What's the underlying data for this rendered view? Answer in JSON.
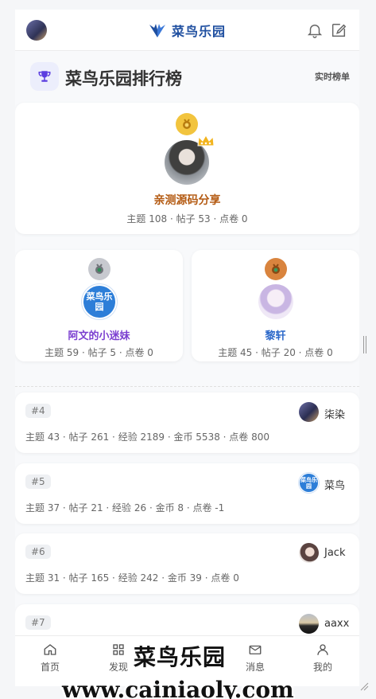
{
  "topbar": {
    "logo_text": "菜鸟乐园",
    "icons": [
      "avatar",
      "bell-icon",
      "edit-icon"
    ]
  },
  "header": {
    "title": "菜鸟乐园排行榜",
    "realtime_label": "实时榜单"
  },
  "podium": {
    "first": {
      "name": "亲测源码分享",
      "stats": "主题 108 · 帖子 53 · 点卷 0"
    },
    "second": {
      "name": "阿文的小迷妹",
      "stats": "主题 59 · 帖子 5 · 点卷 0",
      "avatar_text": "菜鸟乐园"
    },
    "third": {
      "name": "黎轩",
      "stats": "主题 45 · 帖子 20 · 点卷 0"
    }
  },
  "ranks": [
    {
      "rank": "#4",
      "name": "柒染",
      "stats": "主题 43 · 帖子 261 · 经验 2189 · 金币 5538 · 点卷 800"
    },
    {
      "rank": "#5",
      "name": "菜鸟",
      "stats": "主题 37 · 帖子 21 · 经验 26 · 金币 8 · 点卷 -1",
      "avatar_text": "菜鸟乐园"
    },
    {
      "rank": "#6",
      "name": "Jack",
      "stats": "主题 31 · 帖子 165 · 经验 242 · 金币 39 · 点卷 0"
    },
    {
      "rank": "#7",
      "name": "aaxx",
      "stats": ""
    }
  ],
  "bottomnav": {
    "home": "首页",
    "discover": "发现",
    "messages": "消息",
    "mine": "我的"
  },
  "watermark": {
    "brand": "菜鸟乐园",
    "url": "www.cainiaoly.com"
  }
}
